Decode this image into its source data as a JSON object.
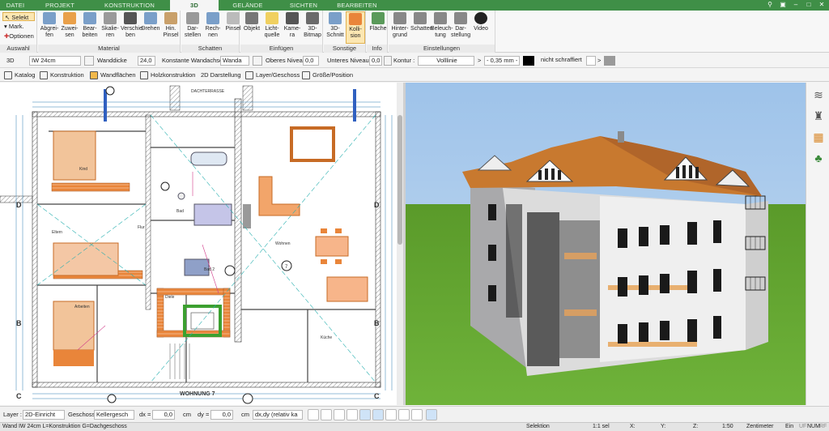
{
  "tabs": [
    "DATEI",
    "PROJEKT",
    "KONSTRUKTION",
    "3D",
    "GELÄNDE",
    "SICHTEN",
    "BEARBEITEN"
  ],
  "active_tab": "3D",
  "ribbon": {
    "auswahl": {
      "selekt": "Selekt",
      "mark": "Mark.",
      "optionen": "Optionen",
      "label": "Auswahl"
    },
    "material": {
      "label": "Material",
      "buttons": [
        "Abgrei-\nfen",
        "Zuwei-\nsen",
        "Bear-\nbeiten",
        "Skalie-\nren",
        "Verschie-\nben",
        "Drehen",
        "Hin.\nPinsel"
      ]
    },
    "schatten": {
      "label": "Schatten",
      "buttons": [
        "Dar-\nstellen",
        "Rech-\nnen",
        "Pinsel"
      ]
    },
    "einfuegen": {
      "label": "Einfügen",
      "buttons": [
        "Objekt",
        "Licht-\nquelle",
        "Kame-\nra",
        "3D-\nBitmap"
      ]
    },
    "sonstige": {
      "label": "Sonstige",
      "buttons": [
        "3D-\nSchnitt",
        "Kolli-\nsion"
      ]
    },
    "info": {
      "label": "Info",
      "buttons": [
        "Fläche"
      ]
    },
    "einstellungen": {
      "label": "Einstellungen",
      "buttons": [
        "Hinter-\ngrund",
        "Schatten",
        "Beleuch-\ntung",
        "Dar-\nstellung",
        "Video"
      ]
    }
  },
  "props": {
    "mode": "3D",
    "wall_type": "IW 24cm",
    "wanddicke_label": "Wanddicke",
    "wanddicke": "24,0",
    "achse_label": "Konstante Wandachse",
    "wanda": "Wanda",
    "oberes_label": "Oberes Niveau",
    "oberes": "0,0",
    "unteres_label": "Unteres Niveau",
    "unteres": "0,0",
    "kontur_label": "Kontur :",
    "linie": "Volllinie",
    "gt1": ">",
    "staerke": "- 0,35 mm -",
    "schraffur": "nicht schraffiert",
    "gt2": ">"
  },
  "toolbar2": [
    "Katalog",
    "Konstruktion",
    "Wandflächen",
    "Holzkonstruktion",
    "2D Darstellung",
    "Layer/Geschoss",
    "Größe/Position"
  ],
  "plan": {
    "title": "WOHNUNG 7",
    "dachterrasse": "DACHTERRASSE",
    "rooms": [
      "Kind",
      "Bad",
      "Flur",
      "Eltern",
      "Wohnen",
      "Arbeiten",
      "Diele",
      "Bad 2",
      "Küche"
    ],
    "section_marks": [
      "D",
      "D",
      "B",
      "B",
      "C",
      "C",
      "7"
    ]
  },
  "bottom": {
    "layer_label": "Layer :",
    "layer": "2D-Einricht",
    "geschoss_label": "Geschoss :",
    "geschoss": "Kellergesch",
    "dx_label": "dx =",
    "dx": "0,0",
    "cm1": "cm",
    "dy_label": "dy =",
    "dy": "0,0",
    "cm2": "cm",
    "mode": "dx,dy (relativ ka"
  },
  "status": {
    "left": "Wand IW 24cm L=Konstruktion G=Dachgeschoss",
    "selektion": "Selektion",
    "scale": "1:1 sel",
    "x": "X:",
    "y": "Y:",
    "z": "Z:",
    "zoom": "1:50",
    "unit": "Zentimeter",
    "ein": "Ein",
    "uf": "UF",
    "num": "NUM",
    "rf": "RF"
  },
  "colors": {
    "accent": "#3f8f47",
    "sky": "#9ec3ea",
    "grass": "#5fa02f",
    "roof": "#c8792f",
    "plan_orange": "#e9853a"
  }
}
